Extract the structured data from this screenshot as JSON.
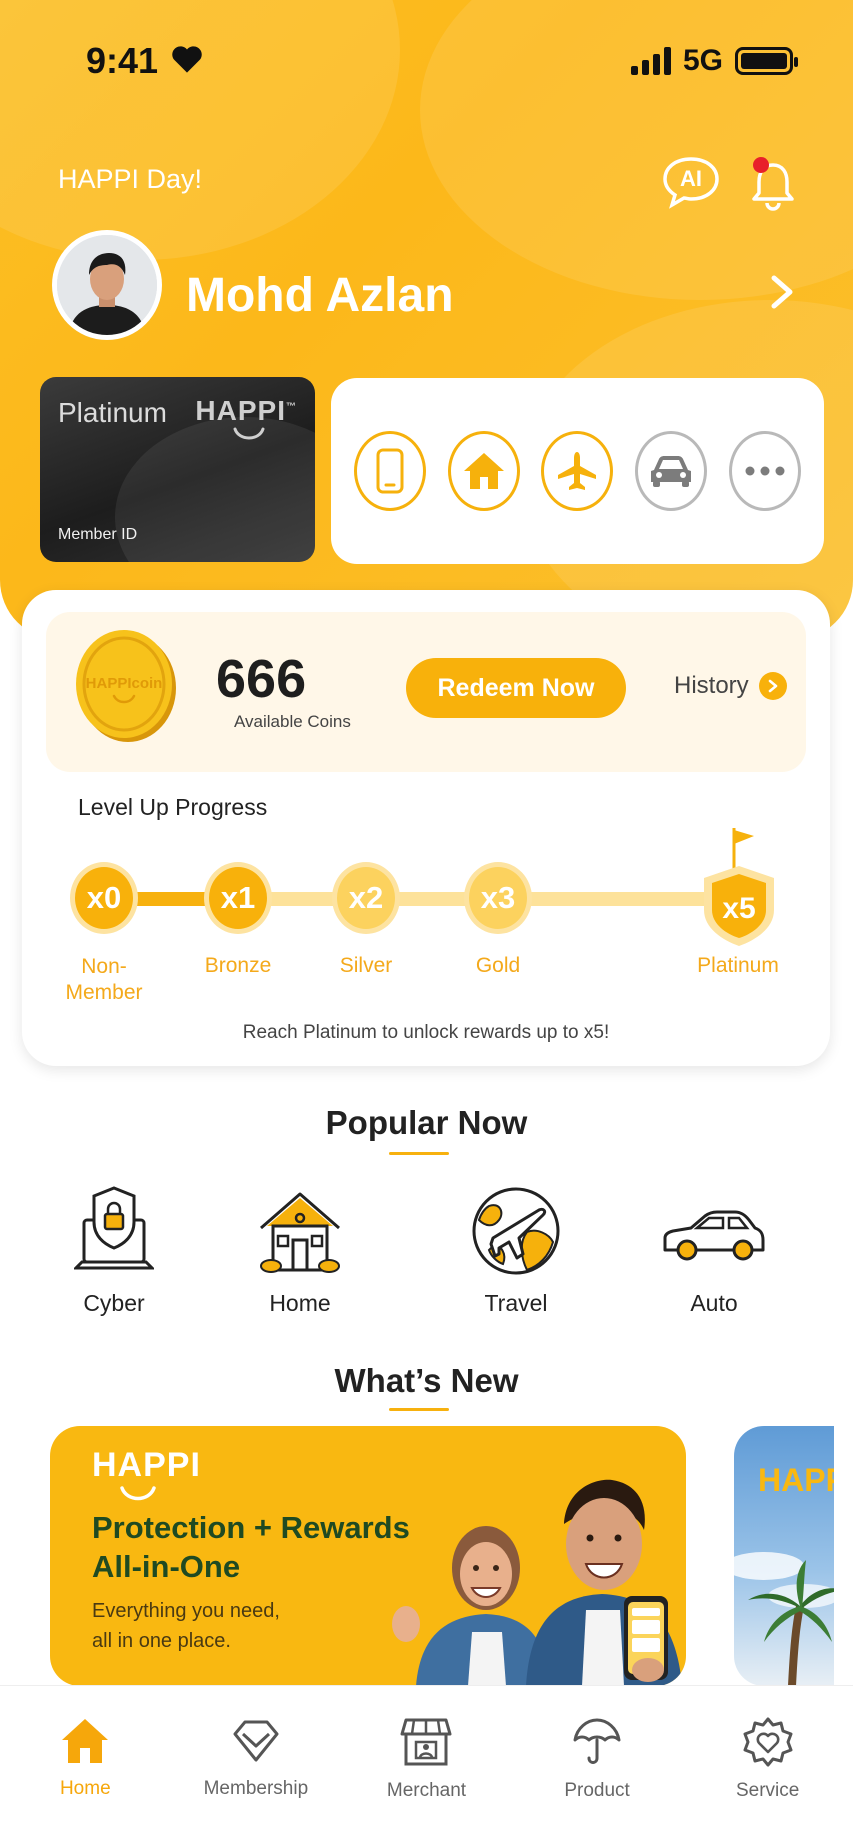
{
  "status_bar": {
    "time": "9:41",
    "network": "5G"
  },
  "header": {
    "greeting": "HAPPI Day!",
    "ai_label": "AI",
    "user_name": "Mohd Azlan"
  },
  "member_card": {
    "tier": "Platinum",
    "brand": "HAPPI",
    "trademark": "™",
    "member_id_label": "Member ID"
  },
  "quick_actions": [
    {
      "icon": "phone-icon"
    },
    {
      "icon": "home-icon"
    },
    {
      "icon": "plane-icon"
    },
    {
      "icon": "car-icon"
    },
    {
      "icon": "more-icon"
    }
  ],
  "coins": {
    "coin_text": "HAPPIcoin",
    "count": "666",
    "label": "Available Coins",
    "redeem_label": "Redeem Now",
    "history_label": "History"
  },
  "level_progress": {
    "title": "Level Up Progress",
    "levels": [
      {
        "mult": "x0",
        "name": "Non-\nMember"
      },
      {
        "mult": "x1",
        "name": "Bronze"
      },
      {
        "mult": "x2",
        "name": "Silver"
      },
      {
        "mult": "x3",
        "name": "Gold"
      },
      {
        "mult": "x5",
        "name": "Platinum"
      }
    ],
    "progress_fraction": 0.16,
    "note": "Reach Platinum to unlock rewards up to x5!"
  },
  "popular": {
    "title": "Popular Now",
    "items": [
      {
        "label": "Cyber",
        "icon": "cyber-shield-icon"
      },
      {
        "label": "Home",
        "icon": "house-icon"
      },
      {
        "label": "Travel",
        "icon": "globe-plane-icon"
      },
      {
        "label": "Auto",
        "icon": "car-outline-icon"
      }
    ]
  },
  "whats_new": {
    "title": "What’s New",
    "banner": {
      "brand": "HAPPI",
      "title_line1": "Protection + Rewards",
      "title_line2": "All-in-One",
      "sub_line1": "Everything you need,",
      "sub_line2": "all in one place."
    },
    "banner2_brand": "HAPP"
  },
  "tabbar": [
    {
      "label": "Home",
      "active": true
    },
    {
      "label": "Membership"
    },
    {
      "label": "Merchant"
    },
    {
      "label": "Product"
    },
    {
      "label": "Service"
    }
  ],
  "colors": {
    "accent": "#f8b10b",
    "header": "#fbbf24",
    "dark_green": "#1f4a22"
  }
}
